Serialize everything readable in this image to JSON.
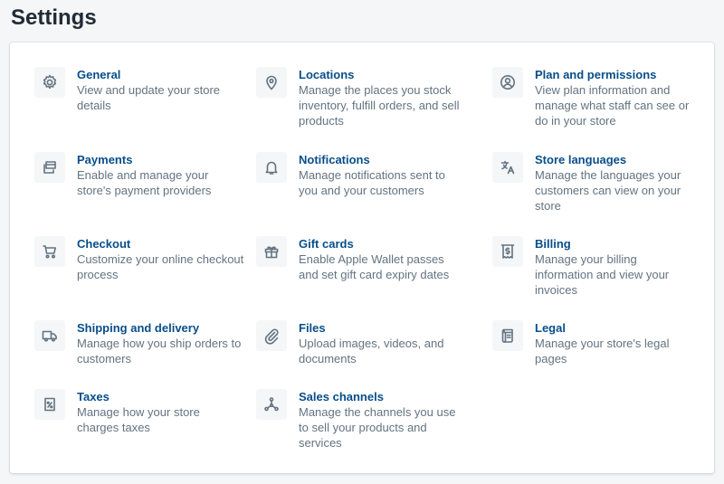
{
  "page": {
    "title": "Settings"
  },
  "settings": {
    "general": {
      "title": "General",
      "description": "View and update your store details",
      "icon": "gear-icon"
    },
    "locations": {
      "title": "Locations",
      "description": "Manage the places you stock inventory, fulfill orders, and sell products",
      "icon": "location-pin-icon"
    },
    "plan": {
      "title": "Plan and permissions",
      "description": "Manage what staff can see or do in your store",
      "description_full": "View plan information and manage what staff can see or do in your store",
      "icon": "user-circle-icon"
    },
    "payments": {
      "title": "Payments",
      "description": "Enable and manage your store's payment providers",
      "icon": "card-icon"
    },
    "notifications": {
      "title": "Notifications",
      "description": "Manage notifications sent to you and your customers",
      "icon": "bell-icon"
    },
    "languages": {
      "title": "Store languages",
      "description": "Manage the languages your customers can view on your store",
      "icon": "translate-icon"
    },
    "checkout": {
      "title": "Checkout",
      "description": "Customize your online checkout process",
      "icon": "cart-icon"
    },
    "gift_cards": {
      "title": "Gift cards",
      "description": "Enable Apple Wallet passes and set gift card expiry dates",
      "icon": "gift-icon"
    },
    "billing": {
      "title": "Billing",
      "description": "Manage your billing information and view your invoices",
      "icon": "billing-icon"
    },
    "shipping": {
      "title": "Shipping and delivery",
      "description": "Manage how you ship orders to customers",
      "icon": "truck-icon"
    },
    "files": {
      "title": "Files",
      "description": "Upload images, videos, and documents",
      "icon": "paperclip-icon"
    },
    "legal": {
      "title": "Legal",
      "description": "Manage your store's legal pages",
      "icon": "scroll-icon"
    },
    "taxes": {
      "title": "Taxes",
      "description": "Manage how your store charges taxes",
      "icon": "tax-icon"
    },
    "sales_channels": {
      "title": "Sales channels",
      "description": "Manage the channels you use to sell your products and services",
      "icon": "channels-icon"
    }
  }
}
